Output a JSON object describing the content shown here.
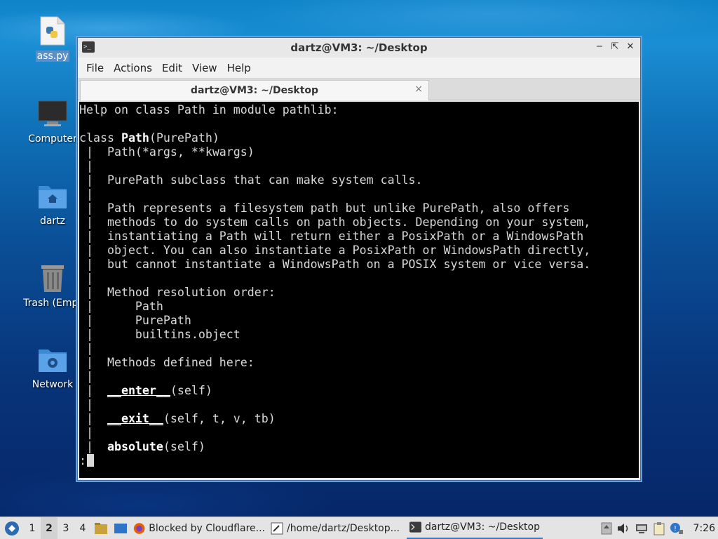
{
  "desktop": {
    "icons": [
      {
        "label": "ass.py",
        "icon": "python-file-icon",
        "selected": true
      },
      {
        "label": "Computer",
        "icon": "computer-icon"
      },
      {
        "label": "dartz",
        "icon": "home-folder-icon"
      },
      {
        "label": "Trash (Empt",
        "icon": "trash-icon"
      },
      {
        "label": "Network",
        "icon": "network-folder-icon"
      }
    ]
  },
  "window": {
    "title": "dartz@VM3: ~/Desktop",
    "controls": [
      "minimize",
      "maximize",
      "close"
    ],
    "menu": [
      "File",
      "Actions",
      "Edit",
      "View",
      "Help"
    ],
    "tab": {
      "label": "dartz@VM3: ~/Desktop",
      "close": "×"
    }
  },
  "terminal": {
    "lines": [
      {
        "text": "Help on class Path in module pathlib:"
      },
      {
        "text": ""
      },
      {
        "parts": [
          [
            "class ",
            ""
          ],
          [
            "Path",
            "b"
          ],
          [
            "(PurePath)",
            ""
          ]
        ]
      },
      {
        "text": " |  Path(*args, **kwargs)"
      },
      {
        "text": " |  "
      },
      {
        "text": " |  PurePath subclass that can make system calls."
      },
      {
        "text": " |  "
      },
      {
        "text": " |  Path represents a filesystem path but unlike PurePath, also offers"
      },
      {
        "text": " |  methods to do system calls on path objects. Depending on your system,"
      },
      {
        "text": " |  instantiating a Path will return either a PosixPath or a WindowsPath"
      },
      {
        "text": " |  object. You can also instantiate a PosixPath or WindowsPath directly,"
      },
      {
        "text": " |  but cannot instantiate a WindowsPath on a POSIX system or vice versa."
      },
      {
        "text": " |  "
      },
      {
        "text": " |  Method resolution order:"
      },
      {
        "text": " |      Path"
      },
      {
        "text": " |      PurePath"
      },
      {
        "text": " |      builtins.object"
      },
      {
        "text": " |  "
      },
      {
        "text": " |  Methods defined here:"
      },
      {
        "text": " |  "
      },
      {
        "parts": [
          [
            " |  ",
            ""
          ],
          [
            "__enter__",
            "b u"
          ],
          [
            "(self)",
            ""
          ]
        ]
      },
      {
        "text": " |  "
      },
      {
        "parts": [
          [
            " |  ",
            ""
          ],
          [
            "__exit__",
            "b u"
          ],
          [
            "(self, t, v, tb)",
            ""
          ]
        ]
      },
      {
        "text": " |  "
      },
      {
        "parts": [
          [
            " |  ",
            ""
          ],
          [
            "absolute",
            "b"
          ],
          [
            "(self)",
            ""
          ]
        ]
      }
    ],
    "prompt": ":"
  },
  "taskbar": {
    "workspaces": [
      "1",
      "2",
      "3",
      "4"
    ],
    "active_workspace": 1,
    "tasks": [
      {
        "label": "Blocked by Cloudflare...",
        "icon": "firefox-icon"
      },
      {
        "label": "/home/dartz/Desktop...",
        "icon": "text-editor-icon"
      },
      {
        "label": "dartz@VM3: ~/Desktop",
        "icon": "terminal-icon",
        "active": true
      }
    ],
    "clock": "7:26"
  }
}
